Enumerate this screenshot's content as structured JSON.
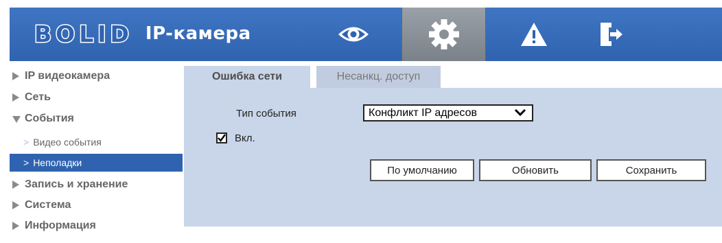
{
  "header": {
    "brand": "BOLID",
    "title": "IP-камера",
    "nav": [
      {
        "name": "live-view",
        "icon": "eye-icon"
      },
      {
        "name": "settings",
        "icon": "gear-icon",
        "active": true
      },
      {
        "name": "alarm",
        "icon": "warning-icon"
      },
      {
        "name": "logout",
        "icon": "exit-icon"
      }
    ],
    "colors": {
      "header_bg": "#2f63b0",
      "active_nav_bg": "#8a9098"
    }
  },
  "sidebar": {
    "items": [
      {
        "label": "IP видеокамера",
        "expanded": false
      },
      {
        "label": "Сеть",
        "expanded": false
      },
      {
        "label": "События",
        "expanded": true
      },
      {
        "label": "Запись и хранение",
        "expanded": false
      },
      {
        "label": "Система",
        "expanded": false
      },
      {
        "label": "Информация",
        "expanded": false
      }
    ],
    "subitems": [
      {
        "label": "Видео события",
        "active": false
      },
      {
        "label": "Неполадки",
        "active": true
      }
    ]
  },
  "tabs": [
    {
      "label": "Ошибка сети",
      "active": true
    },
    {
      "label": "Несанкц. доступ",
      "active": false
    }
  ],
  "form": {
    "event_type_label": "Тип события",
    "event_type_value": "Конфликт IP адресов",
    "enable_label": "Вкл.",
    "enable_checked": true
  },
  "buttons": {
    "default_label": "По умолчанию",
    "refresh_label": "Обновить",
    "save_label": "Сохранить"
  }
}
